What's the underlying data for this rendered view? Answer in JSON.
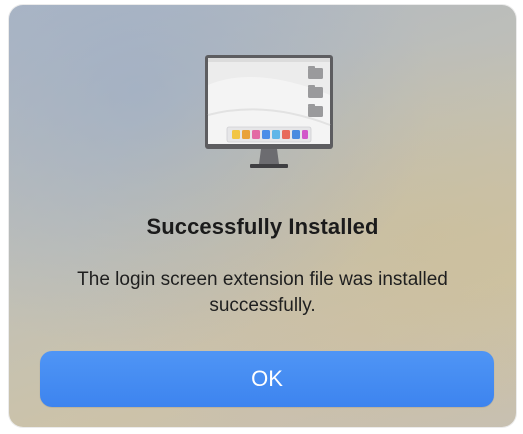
{
  "dialog": {
    "title": "Successfully Installed",
    "message": "The login screen extension file was installed successfully.",
    "ok_label": "OK",
    "icon": "monitor-icon",
    "accent_color": "#3d84ef"
  }
}
